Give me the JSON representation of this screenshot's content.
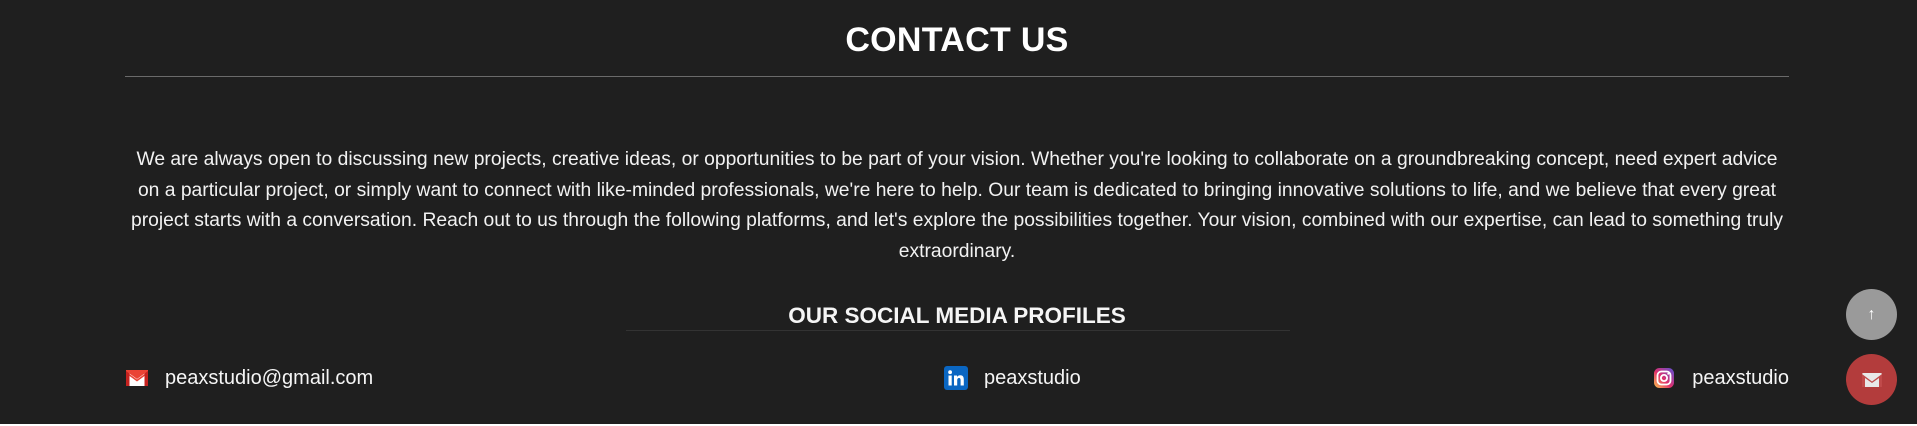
{
  "contact": {
    "title": "CONTACT US",
    "intro": "We are always open to discussing new projects, creative ideas, or opportunities to be part of your vision. Whether you're looking to collaborate on a groundbreaking concept, need expert advice on a particular project, or simply want to connect with like-minded professionals, we're here to help. Our team is dedicated to bringing innovative solutions to life, and we believe that every great project starts with a conversation. Reach out to us through the following platforms, and let's explore the possibilities together. Your vision, combined with our expertise, can lead to something truly extraordinary."
  },
  "social": {
    "title": "OUR SOCIAL MEDIA PROFILES",
    "items": [
      {
        "icon": "gmail-icon",
        "label": "peaxstudio@gmail.com"
      },
      {
        "icon": "linkedin-icon",
        "label": "peaxstudio"
      },
      {
        "icon": "instagram-icon",
        "label": "peaxstudio"
      }
    ]
  },
  "floating": {
    "scroll_top_glyph": "↑",
    "scroll_top_icon": "arrow-up-icon",
    "mail_icon": "mail-icon"
  },
  "colors": {
    "background": "#1f1f1f",
    "gmail_red": "#ea4335",
    "linkedin_blue": "#0a66c2",
    "scroll_button": "#9a9a9a",
    "mail_button": "#b33c3c"
  }
}
